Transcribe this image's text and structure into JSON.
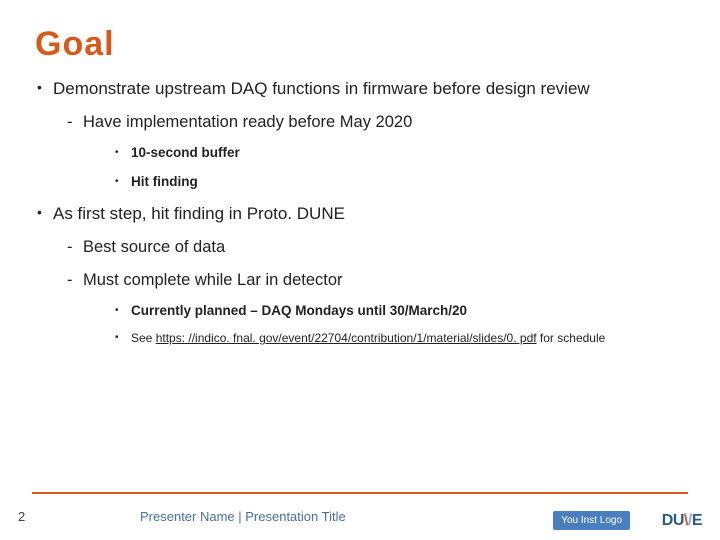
{
  "title": "Goal",
  "bullets": {
    "b1": "Demonstrate upstream DAQ functions in firmware before design review",
    "b1_1": "Have implementation ready before May 2020",
    "b1_1_1": "10-second buffer",
    "b1_1_2": "Hit finding",
    "b2": "As first step, hit finding in Proto. DUNE",
    "b2_1": "Best source of data",
    "b2_2": "Must complete while Lar in detector",
    "b2_2_1": "Currently planned – DAQ Mondays until 30/March/20",
    "b2_2_2_pre": "See ",
    "b2_2_2_link": "https: //indico. fnal. gov/event/22704/contribution/1/material/slides/0. pdf",
    "b2_2_2_post": " for schedule"
  },
  "footer": {
    "page": "2",
    "meta": "Presenter Name | Presentation Title",
    "inst_logo": "You Inst Logo",
    "dune": {
      "d": "D",
      "u": "U",
      "v1": "\\",
      "v2": "/",
      "e": "E"
    }
  }
}
